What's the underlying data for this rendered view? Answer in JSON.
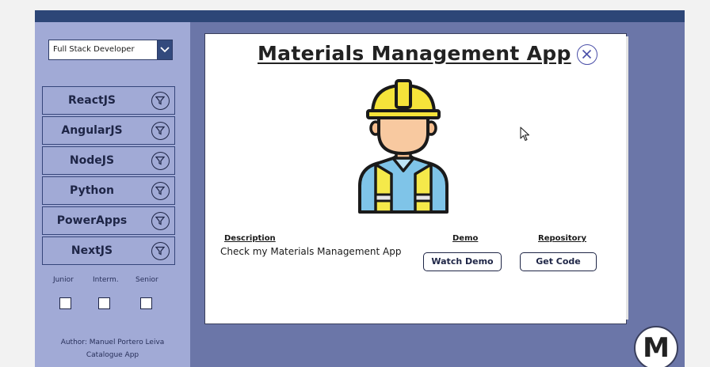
{
  "role_dropdown": {
    "selected": "Full Stack Developer"
  },
  "technologies": [
    {
      "label": "ReactJS"
    },
    {
      "label": "AngularJS"
    },
    {
      "label": "NodeJS"
    },
    {
      "label": "Python"
    },
    {
      "label": "PowerApps"
    },
    {
      "label": "NextJS"
    }
  ],
  "levels": [
    {
      "label": "Junior",
      "checked": false
    },
    {
      "label": "Interm.",
      "checked": false
    },
    {
      "label": "Senior",
      "checked": false
    }
  ],
  "footer": {
    "author": "Author: Manuel Portero Leiva",
    "subtitle": "Catalogue App"
  },
  "detail": {
    "title": "Materials Management App",
    "description_header": "Description",
    "description": "Check my Materials Management App",
    "demo_header": "Demo",
    "demo_button": "Watch Demo",
    "repo_header": "Repository",
    "repo_button": "Get Code"
  },
  "logo": {
    "letter": "M"
  },
  "icons": {
    "filter": "filter-icon",
    "close": "close-icon",
    "dropdown": "chevron-down-icon",
    "worker": "construction-worker-icon"
  },
  "colors": {
    "topbar": "#2d4677",
    "sidebar": "#a1aad6",
    "background": "#6b76a8",
    "button_border": "#1e2546"
  }
}
